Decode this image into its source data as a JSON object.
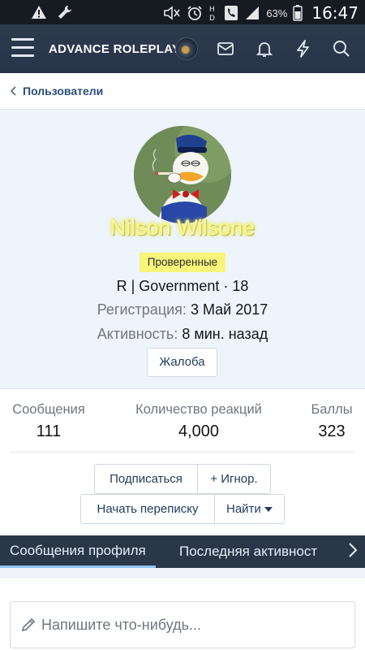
{
  "status_bar": {
    "battery": "63%",
    "time": "16:47",
    "icons": [
      "warning-icon",
      "wrench-icon",
      "mute-icon",
      "alarm-icon",
      "hd-icon",
      "phone-icon",
      "signal-icon",
      "battery-icon"
    ]
  },
  "header": {
    "brand": "ADVANCE ROLEPLAY",
    "icons": [
      "menu-icon",
      "avatar",
      "envelope-icon",
      "bell-icon",
      "lightning-icon",
      "search-icon"
    ]
  },
  "breadcrumb": {
    "label": "Пользователи"
  },
  "profile": {
    "username": "Nilson Wilsone",
    "badge": "Проверенные",
    "title_line": "R | Government · 18",
    "registration_label": "Регистрация:",
    "registration_value": "3 Май 2017",
    "activity_label": "Активность:",
    "activity_value": "8 мин. назад",
    "report_button": "Жалоба"
  },
  "stats": [
    {
      "label": "Сообщения",
      "value": "111"
    },
    {
      "label": "Количество реакций",
      "value": "4,000"
    },
    {
      "label": "Баллы",
      "value": "323"
    }
  ],
  "actions": {
    "follow": "Подписаться",
    "ignore": "+ Игнор.",
    "start_conversation": "Начать переписку",
    "find": "Найти"
  },
  "tabs": [
    {
      "label": "Сообщения профиля",
      "active": true
    },
    {
      "label": "Последняя активност",
      "active": false
    }
  ],
  "compose": {
    "placeholder": "Напишите что-нибудь..."
  },
  "colors": {
    "header_bg": "#2e3b4d",
    "profile_bg": "#edf4fb",
    "username_glow": "#f8f89a",
    "badge_bg": "#f7f57a",
    "link": "#2a4e78",
    "tab_indicator": "#8ec3f0"
  }
}
